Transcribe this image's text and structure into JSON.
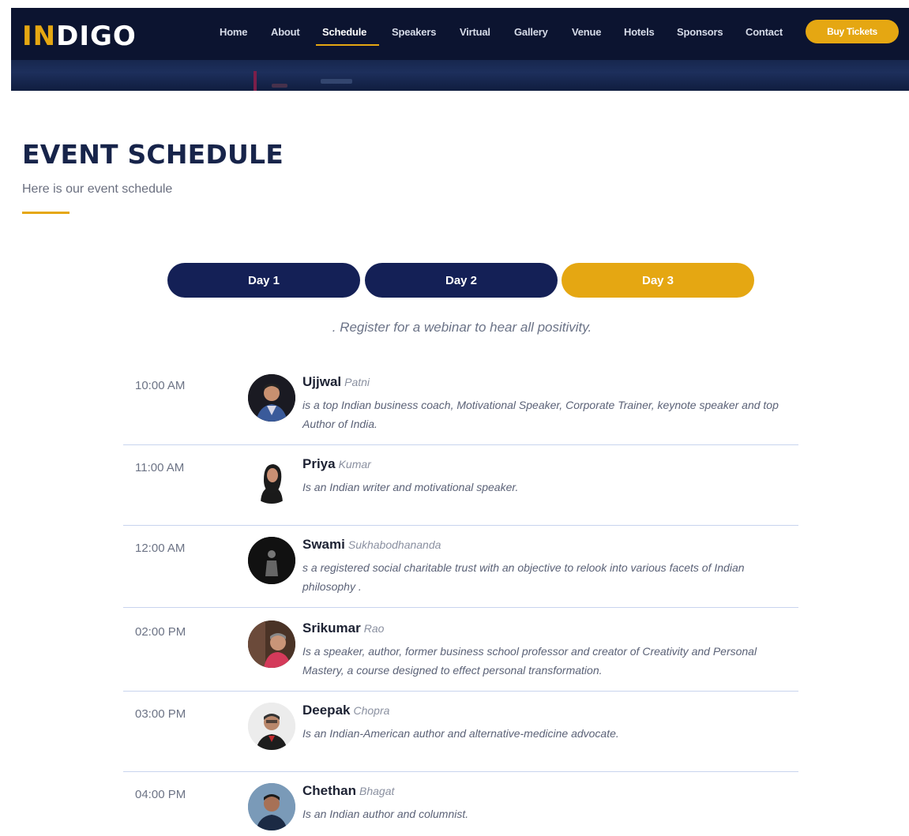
{
  "brand": {
    "logo_accent": "IN",
    "logo_rest": "DIGO",
    "accent_color": "#e5a712",
    "navy_color": "#142056"
  },
  "nav": {
    "items": [
      {
        "label": "Home"
      },
      {
        "label": "About"
      },
      {
        "label": "Schedule",
        "active": true
      },
      {
        "label": "Speakers"
      },
      {
        "label": "Virtual"
      },
      {
        "label": "Gallery"
      },
      {
        "label": "Venue"
      },
      {
        "label": "Hotels"
      },
      {
        "label": "Sponsors"
      },
      {
        "label": "Contact"
      }
    ],
    "cta_label": "Buy Tickets"
  },
  "section": {
    "title": "EVENT SCHEDULE",
    "subtitle": "Here is our event schedule"
  },
  "tabs": [
    {
      "label": "Day 1",
      "active": false
    },
    {
      "label": "Day 2",
      "active": false
    },
    {
      "label": "Day 3",
      "active": true
    }
  ],
  "intro": ". Register for a webinar to hear all positivity.",
  "schedule": [
    {
      "time": "10:00 AM",
      "first": "Ujjwal",
      "last": "Patni",
      "desc": "is a top Indian business coach, Motivational Speaker, Corporate Trainer, keynote speaker and top Author of India."
    },
    {
      "time": "11:00 AM",
      "first": "Priya",
      "last": "Kumar",
      "desc": "Is an Indian writer and motivational speaker."
    },
    {
      "time": "12:00 AM",
      "first": "Swami",
      "last": "Sukhabodhananda",
      "desc": "s a registered social charitable trust with an objective to relook into various facets of Indian philosophy ."
    },
    {
      "time": "02:00 PM",
      "first": "Srikumar",
      "last": "Rao",
      "desc": "Is a speaker, author, former business school professor and creator of Creativity and Personal Mastery, a course designed to effect personal transformation."
    },
    {
      "time": "03:00 PM",
      "first": "Deepak",
      "last": "Chopra",
      "desc": "Is an Indian-American author and alternative-medicine advocate."
    },
    {
      "time": "04:00 PM",
      "first": "Chethan",
      "last": "Bhagat",
      "desc": "Is an Indian author and columnist."
    }
  ]
}
